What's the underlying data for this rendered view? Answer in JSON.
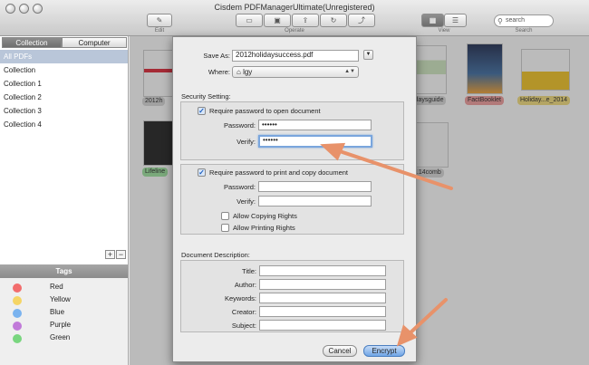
{
  "window": {
    "title": "Cisdem PDFManagerUltimate(Unregistered)"
  },
  "toolbar": {
    "edit_caption": "Edit",
    "operate_caption": "Operate",
    "view_caption": "View",
    "search_caption": "Search",
    "search_placeholder": "search"
  },
  "sidebar": {
    "segments": [
      "Collection",
      "Computer"
    ],
    "collections": [
      "All PDFs",
      "Collection",
      "Collection 1",
      "Collection 2",
      "Collection 3",
      "Collection 4"
    ],
    "add_label": "+",
    "remove_label": "−",
    "tags_title": "Tags",
    "tags": [
      {
        "label": "Red",
        "color": "#f26d6d"
      },
      {
        "label": "Yellow",
        "color": "#f5d565"
      },
      {
        "label": "Blue",
        "color": "#7ab3ef"
      },
      {
        "label": "Purple",
        "color": "#c17ad9"
      },
      {
        "label": "Green",
        "color": "#79d67f"
      }
    ]
  },
  "library": {
    "labels": [
      "2012h",
      "Lifeline",
      "idaysguide",
      "FactBooklet",
      "Holiday...e_2014",
      "...14comb"
    ],
    "label_colors": {
      "red": "#f29b9b",
      "yellow": "#f5de7a",
      "green": "#9be39d",
      "gray": "#d8d8d8"
    }
  },
  "dialog": {
    "save_as_label": "Save As:",
    "save_as_value": "2012holidaysuccess.pdf",
    "where_label": "Where:",
    "where_value": "lgy",
    "security_label": "Security Setting:",
    "open_pw_checkbox": "Require password to open document",
    "password_label": "Password:",
    "verify_label": "Verify:",
    "open_password_value": "••••••",
    "open_verify_value": "••••••",
    "print_pw_checkbox": "Require password to print and copy document",
    "print_password_label": "Password:",
    "print_verify_label": "Verify:",
    "allow_copying": "Allow Copying Rights",
    "allow_printing": "Allow Printing Rights",
    "description_label": "Document Description:",
    "title_label": "Title:",
    "author_label": "Author:",
    "keywords_label": "Keywords:",
    "creator_label": "Creator:",
    "subject_label": "Subject:",
    "cancel_label": "Cancel",
    "encrypt_label": "Encrypt"
  },
  "colors": {
    "annotation_arrow": "#e8926a",
    "focus_ring": "#7aa6dd"
  }
}
